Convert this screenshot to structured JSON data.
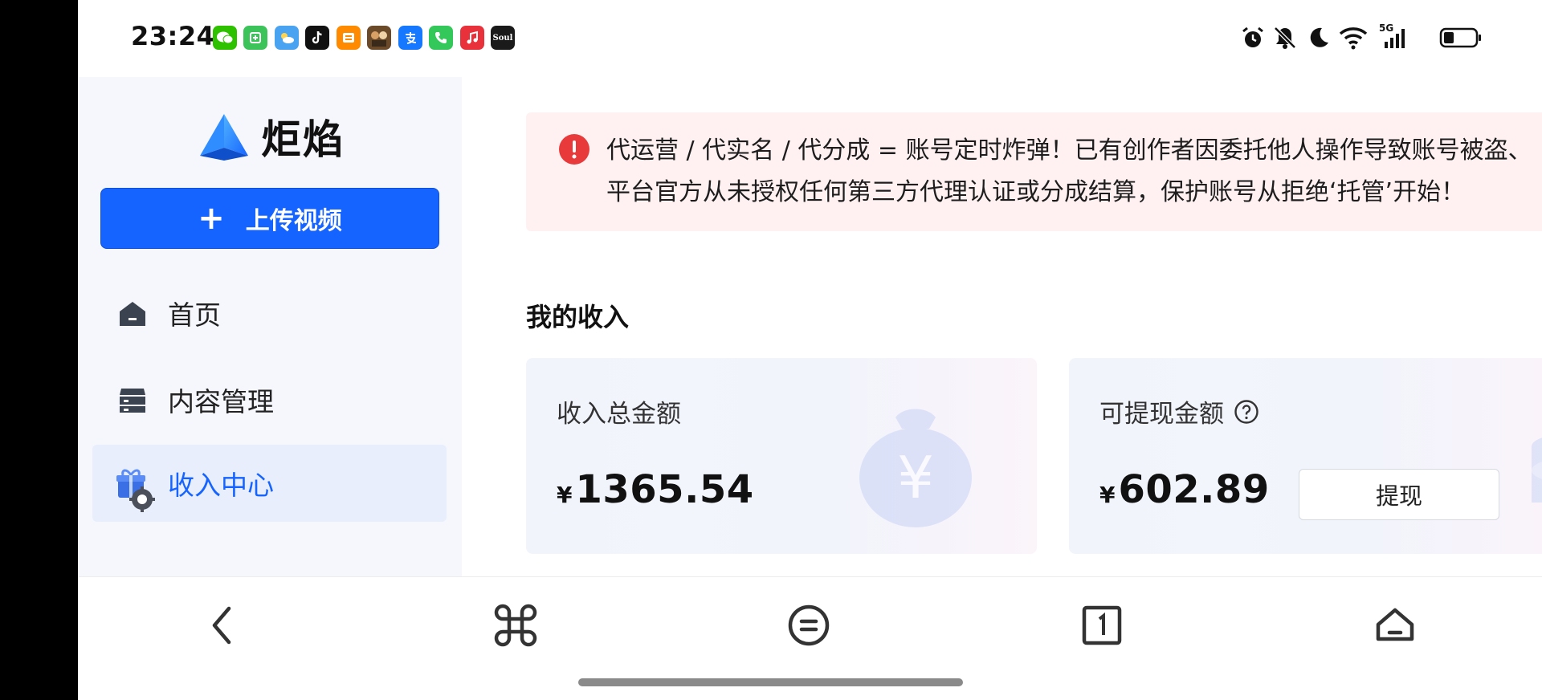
{
  "status_bar": {
    "time": "23:24",
    "apps": [
      {
        "name": "wechat-icon",
        "color": "#2dc100"
      },
      {
        "name": "app-green-icon",
        "color": "#3cc35a"
      },
      {
        "name": "weather-icon",
        "color": "#4aa3f0"
      },
      {
        "name": "tiktok-icon",
        "color": "#111111"
      },
      {
        "name": "app-orange-icon",
        "color": "#ff8a00"
      },
      {
        "name": "game-icon",
        "color": "#6b4a2a"
      },
      {
        "name": "alipay-icon",
        "color": "#1677ff"
      },
      {
        "name": "phone-icon",
        "color": "#34c759"
      },
      {
        "name": "music-icon",
        "color": "#e8313a"
      },
      {
        "name": "soul-icon",
        "color": "#1a1a1a"
      }
    ],
    "soul_label": "Soul",
    "network_label": "5G"
  },
  "sidebar": {
    "logo_text": "炬焰",
    "upload_label": "上传视频",
    "items": [
      {
        "label": "首页",
        "icon": "home-icon"
      },
      {
        "label": "内容管理",
        "icon": "content-icon"
      },
      {
        "label": "收入中心",
        "icon": "gift-icon",
        "active": true
      }
    ]
  },
  "notice": {
    "line1": "代运营 / 代实名 / 代分成 = 账号定时炸弹！已有创作者因委托他人操作导致账号被盗、",
    "line2": "平台官方从未授权任何第三方代理认证或分成结算，保护账号从拒绝‘托管’开始！"
  },
  "income": {
    "title": "我的收入",
    "total": {
      "label": "收入总金额",
      "currency": "¥",
      "amount": "1365.54"
    },
    "withdrawable": {
      "label": "可提现金额",
      "currency": "¥",
      "amount": "602.89",
      "button": "提现"
    }
  },
  "colors": {
    "accent": "#1664ff",
    "warning": "#e83a3a",
    "notice_bg": "#fff1f1"
  }
}
